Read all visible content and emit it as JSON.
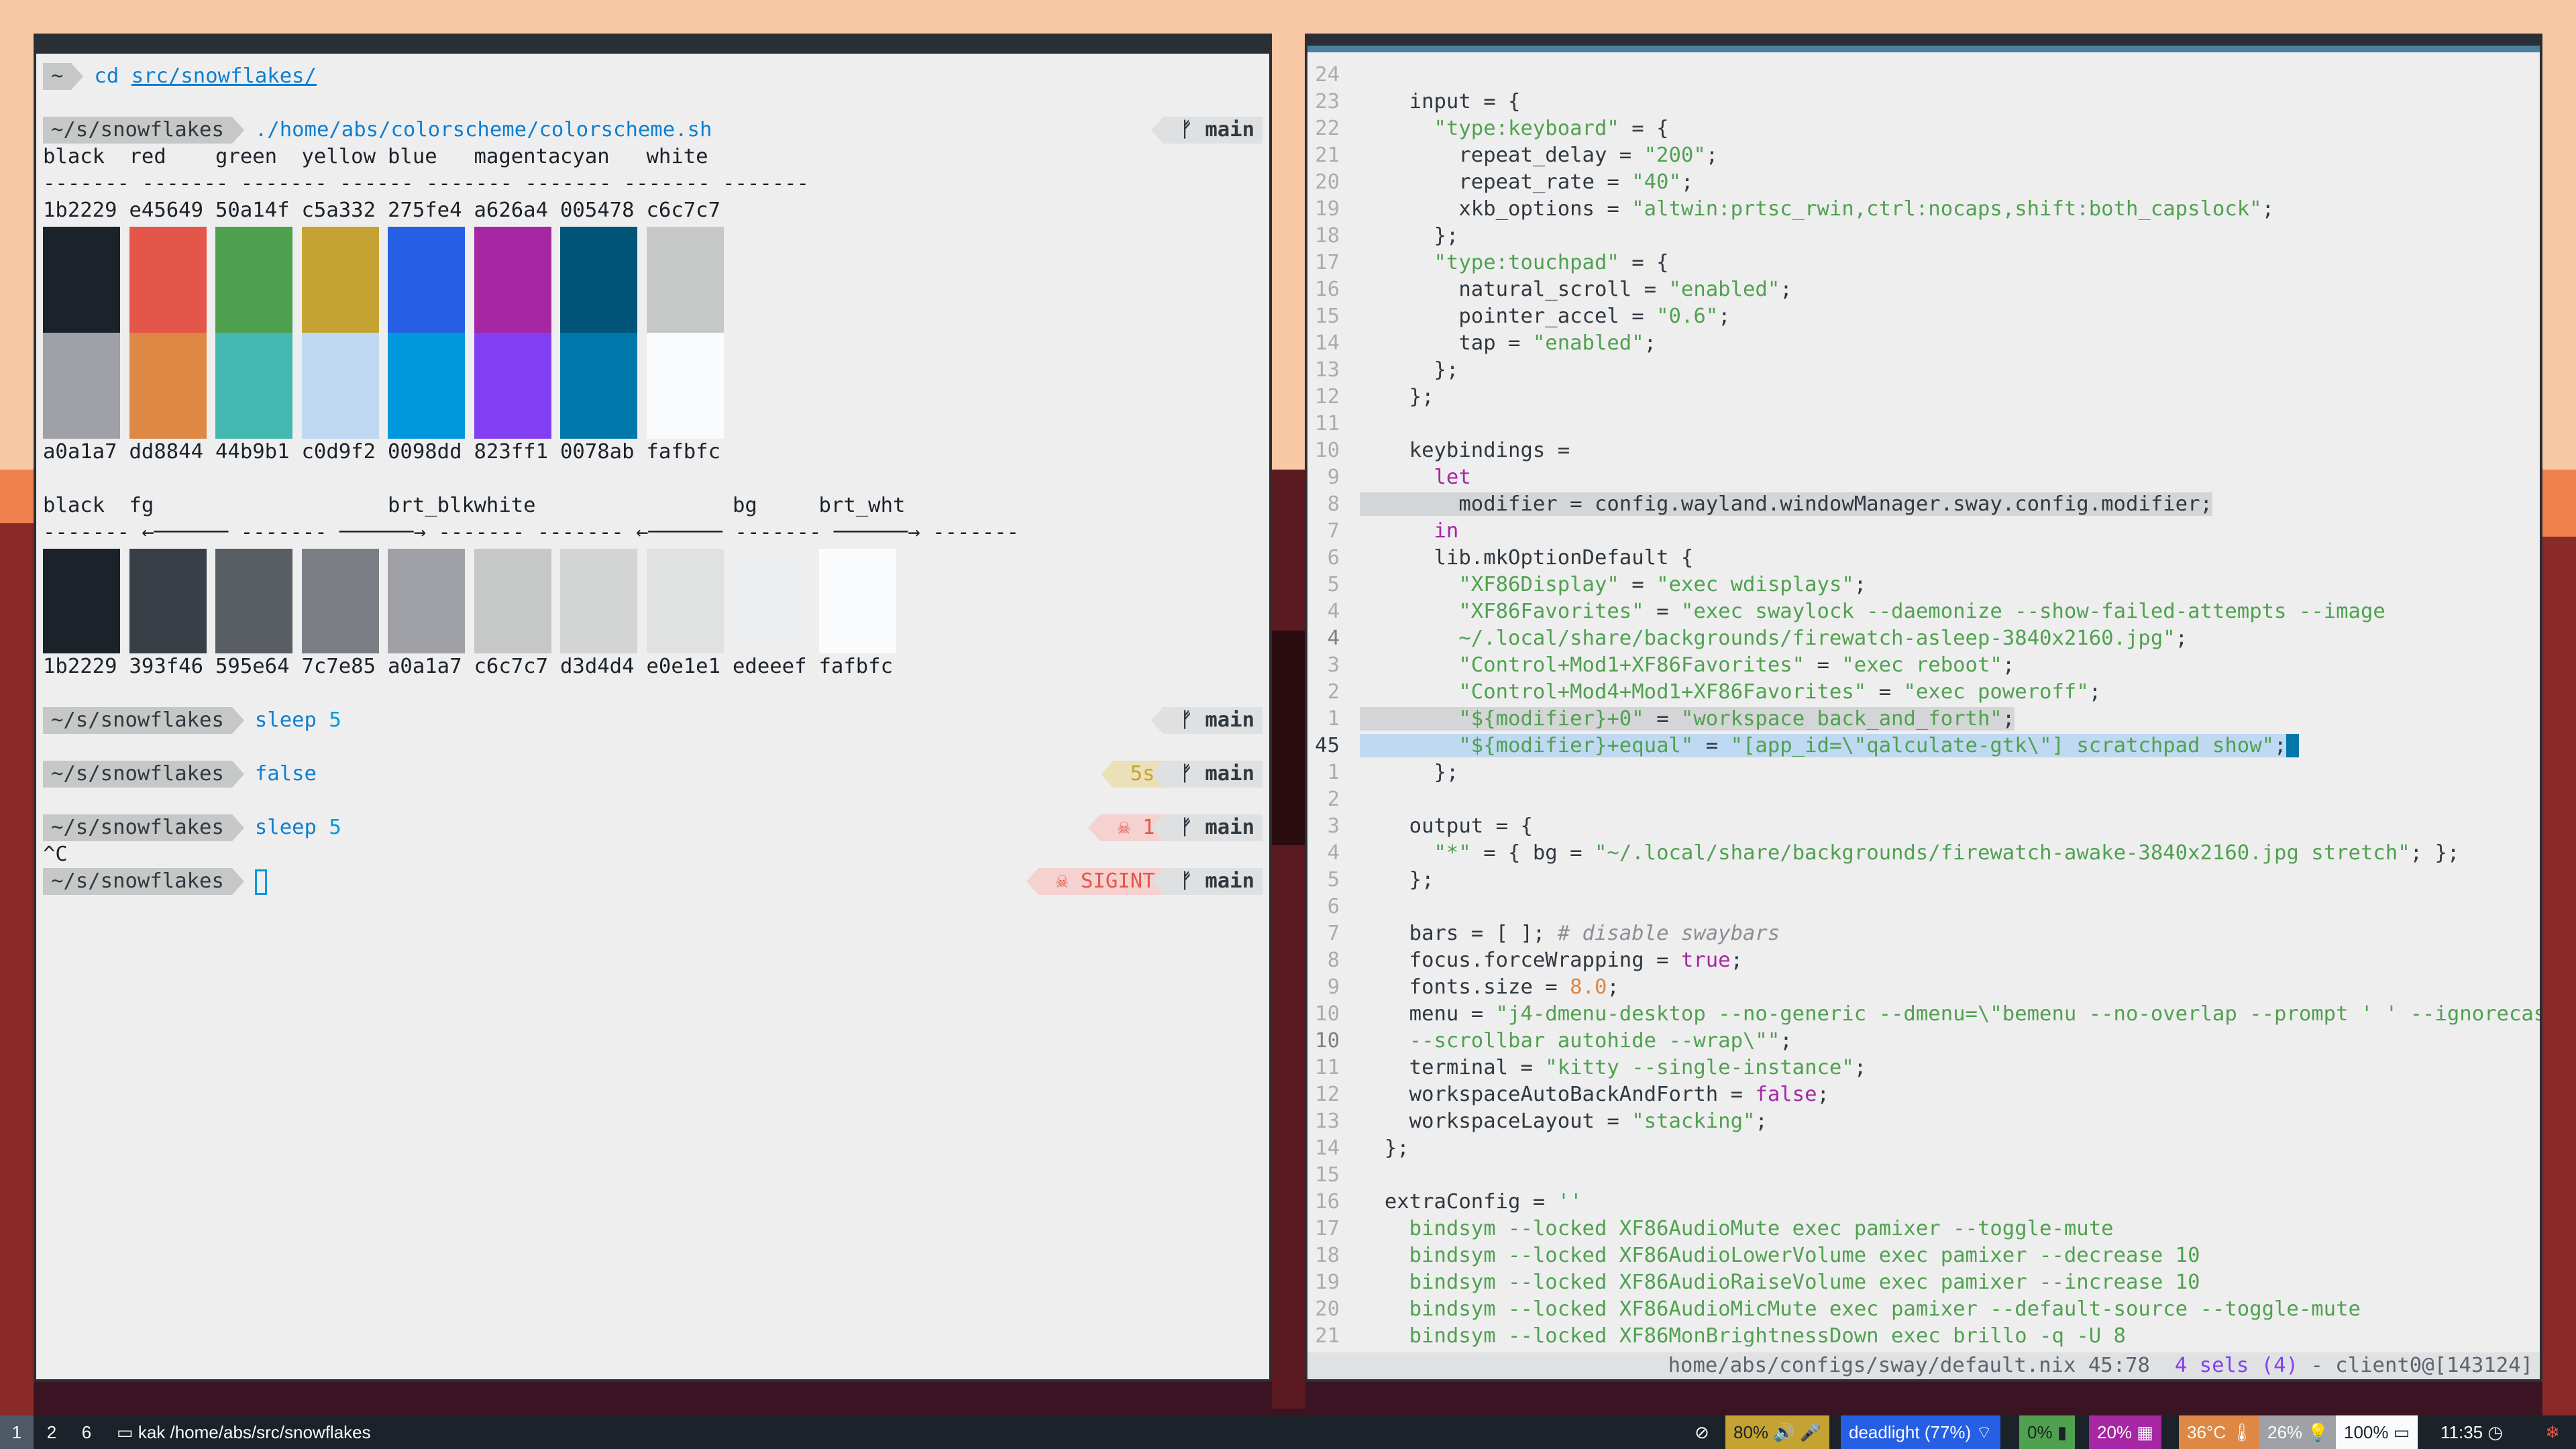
{
  "terminal": {
    "cmd1": {
      "dir": "~",
      "cmd": "cd",
      "arg": "src/snowflakes/"
    },
    "cmd2": {
      "dir": "~/s/snowflakes",
      "cmd": "./home/abs/colorscheme/colorscheme.sh",
      "branch": "main"
    },
    "names1": [
      "black",
      "red",
      "green",
      "yellow",
      "blue",
      "magenta",
      "cyan",
      "white"
    ],
    "dashes1": "------- ------- ------- ------ ------- ------- ------- -------",
    "top_codes": [
      "1b2229",
      "e45649",
      "50a14f",
      "c5a332",
      "275fe4",
      "a626a4",
      "005478",
      "c6c7c7"
    ],
    "bottom_codes": [
      "a0a1a7",
      "dd8844",
      "44b9b1",
      "c0d9f2",
      "0098dd",
      "823ff1",
      "0078ab",
      "fafbfc"
    ],
    "names2": [
      "black",
      "fg",
      "brt_blk",
      "white",
      "bg",
      "brt_wht"
    ],
    "codes2": [
      "1b2229",
      "393f46",
      "595e64",
      "7c7e85",
      "a0a1a7",
      "c6c7c7",
      "d3d4d4",
      "e0e1e1",
      "edeeef",
      "fafbfc"
    ],
    "cmd3": {
      "dir": "~/s/snowflakes",
      "cmd": "sleep",
      "arg": "5",
      "branch": "main"
    },
    "cmd4": {
      "dir": "~/s/snowflakes",
      "cmd": "false",
      "duration": "5s",
      "branch": "main"
    },
    "cmd5": {
      "dir": "~/s/snowflakes",
      "cmd": "sleep",
      "arg": "5",
      "exit": "1",
      "branch": "main"
    },
    "ctrl_c": "^C",
    "cmd6": {
      "dir": "~/s/snowflakes",
      "signal": "SIGINT",
      "branch": "main"
    }
  },
  "editor": {
    "status": {
      "path": "home/abs/configs/sway/default.nix 45:78",
      "sels": "4 sels (4)",
      "client": "- client0@[143124]"
    }
  },
  "colors": {
    "swatch_top": [
      "#1b2229",
      "#e45649",
      "#50a14f",
      "#c5a332",
      "#275fe4",
      "#a626a4",
      "#005478",
      "#c6c7c7"
    ],
    "swatch_bottom": [
      "#a0a1a7",
      "#dd8844",
      "#44b9b1",
      "#c0d9f2",
      "#0098dd",
      "#823ff1",
      "#0078ab",
      "#fafbfc"
    ],
    "swatch_row2": [
      "#1b2229",
      "#393f46",
      "#595e64",
      "#7c7e85",
      "#a0a1a7",
      "#c6c7c7",
      "#d3d4d4",
      "#e0e1e1",
      "#edeeef",
      "#fafbfc"
    ]
  },
  "bar": {
    "workspaces": [
      "1",
      "2",
      "6"
    ],
    "window_title": "kak /home/abs/src/snowflakes",
    "volume": "80%",
    "wifi": "deadlight (77%)",
    "battery": "0%",
    "cpu": "20%",
    "temp": "36°C",
    "memory": "26%",
    "brightness": "100%",
    "clock": "11:35"
  }
}
